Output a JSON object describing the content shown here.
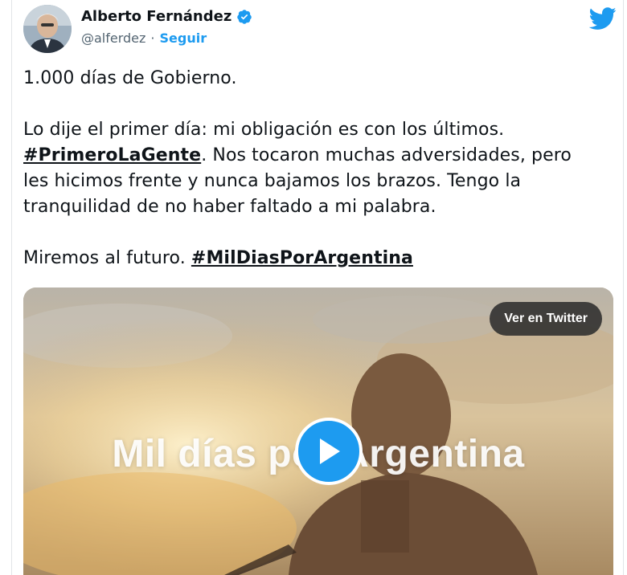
{
  "author": {
    "name": "Alberto Fernández",
    "handle": "@alferdez",
    "separator": "·",
    "follow_label": "Seguir",
    "verified_icon": "verified-badge-icon"
  },
  "brand_icon": "twitter-bird-icon",
  "tweet": {
    "line1": "1.000 días de Gobierno.",
    "para2_prefix": "Lo dije el primer día: mi obligación es con los últimos.",
    "hashtag1": "#PrimeroLaGente",
    "para2_rest": ". Nos tocaron muchas adversidades, pero les hicimos frente y nunca bajamos los brazos. Tengo la tranquilidad de no haber faltado a mi palabra.",
    "para3_prefix": "Miremos al futuro. ",
    "hashtag2": "#MilDiasPorArgentina"
  },
  "media": {
    "view_button": "Ver en Twitter",
    "overlay_text": "Mil días por Argentina",
    "play_icon": "play-icon"
  },
  "colors": {
    "accent": "#1d9bf0",
    "text": "#0f1419",
    "secondary": "#536471"
  }
}
